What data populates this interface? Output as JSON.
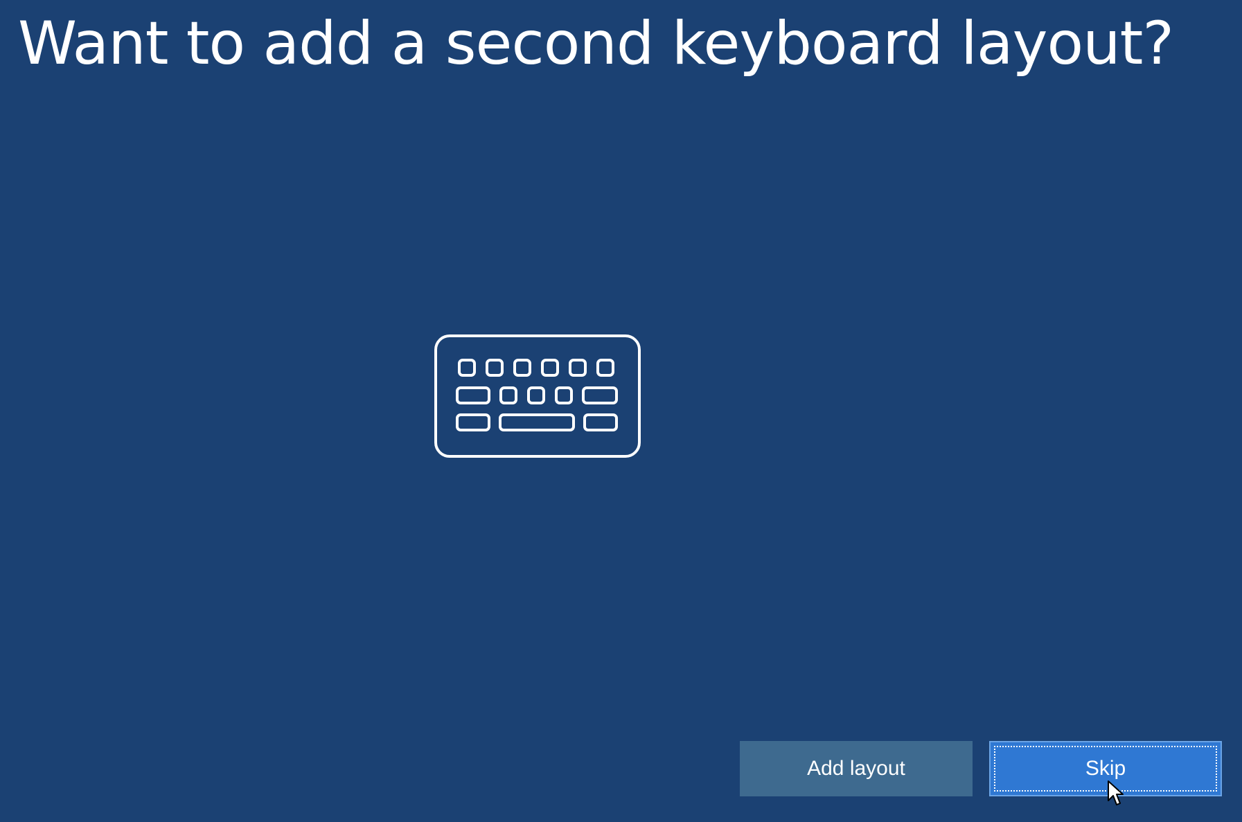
{
  "page": {
    "title": "Want to add a second keyboard layout?"
  },
  "icons": {
    "main": "keyboard-icon",
    "pointer": "mouse-cursor-icon"
  },
  "actions": {
    "add_layout_label": "Add layout",
    "skip_label": "Skip"
  },
  "colors": {
    "background": "#1b4173",
    "secondary_button": "#3e6a8f",
    "primary_button": "#2f78d3",
    "text": "#ffffff"
  }
}
